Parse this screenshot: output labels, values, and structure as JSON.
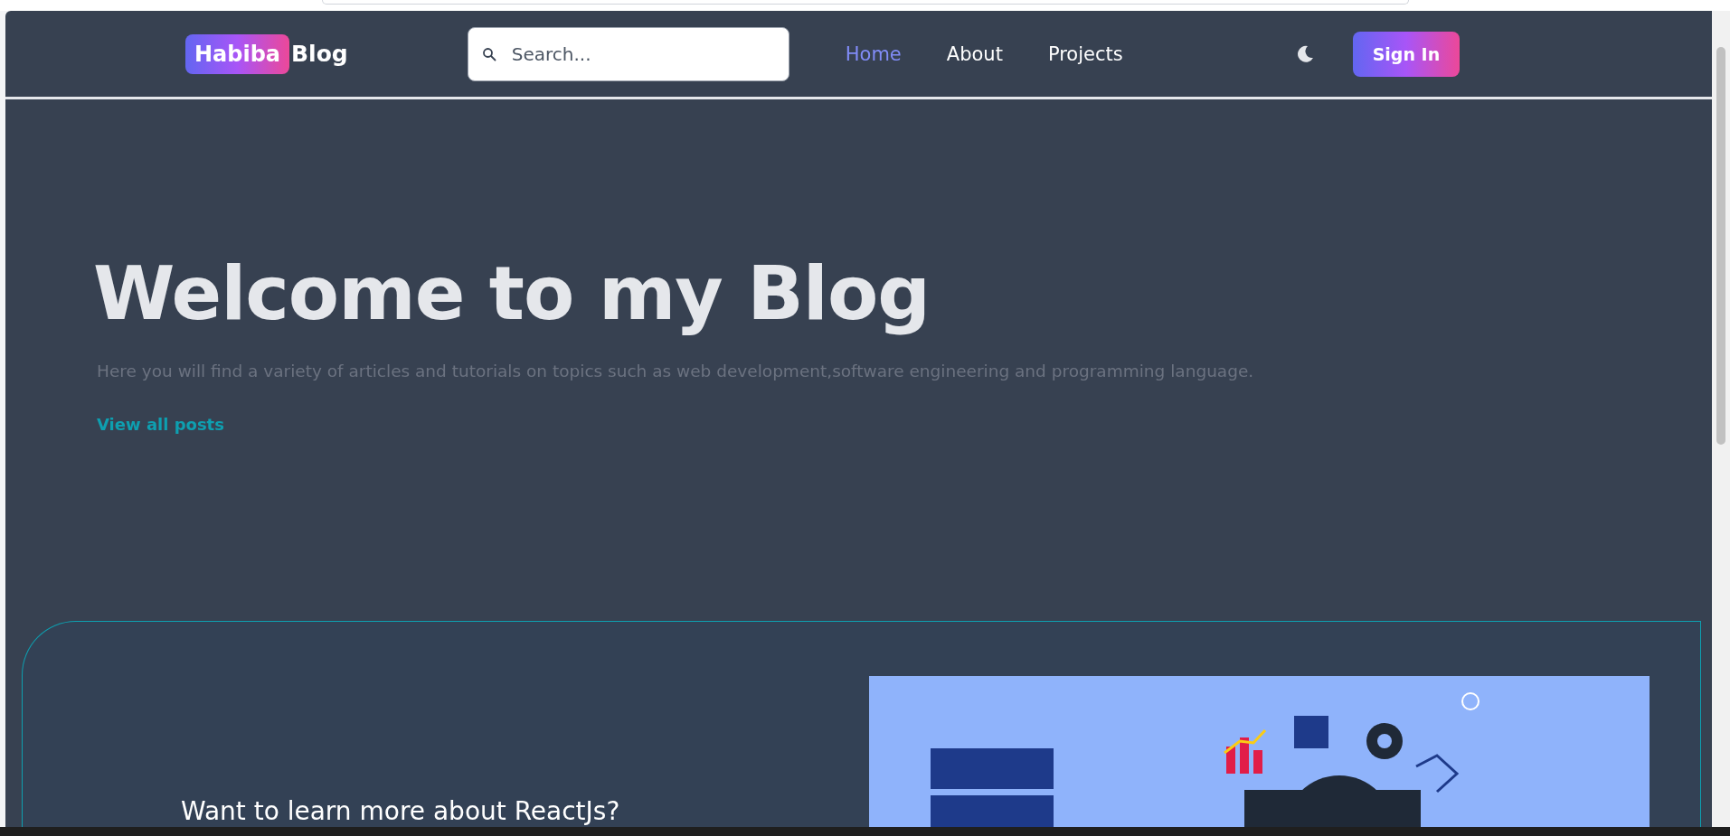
{
  "header": {
    "logo_badge": "Habiba",
    "logo_text": "Blog",
    "search": {
      "placeholder": "Search..."
    },
    "nav": [
      {
        "label": "Home",
        "selected": true
      },
      {
        "label": "About",
        "selected": false
      },
      {
        "label": "Projects",
        "selected": false
      }
    ],
    "sign_in": "Sign In"
  },
  "hero": {
    "title": "Welcome to my Blog",
    "subtitle": "Here you will find a variety of articles and tutorials on topics such as web development,software engineering and programming language.",
    "link": "View all posts"
  },
  "promo": {
    "heading": "Want to learn more about ReactJs?"
  }
}
